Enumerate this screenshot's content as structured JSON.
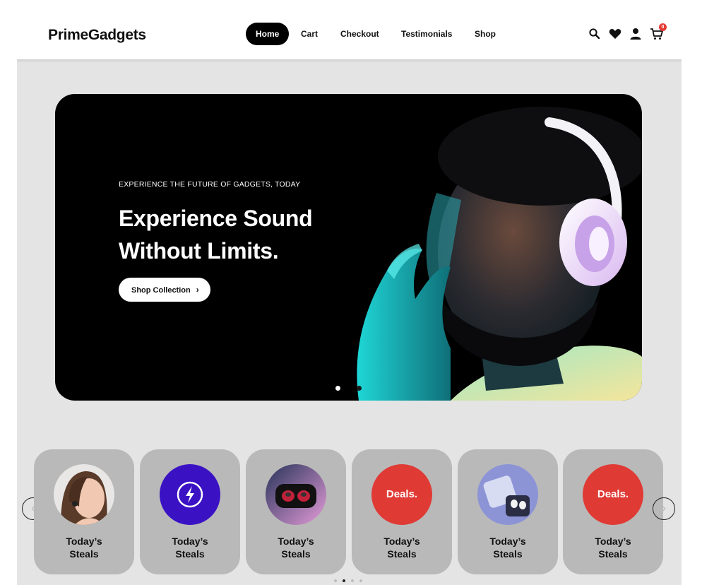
{
  "header": {
    "logo": "PrimeGadgets",
    "nav": [
      {
        "label": "Home",
        "active": true
      },
      {
        "label": "Cart",
        "active": false
      },
      {
        "label": "Checkout",
        "active": false
      },
      {
        "label": "Testimonials",
        "active": false
      },
      {
        "label": "Shop",
        "active": false
      }
    ],
    "icons": [
      "search-icon",
      "heart-icon",
      "user-icon",
      "cart-icon"
    ],
    "cart_count": "0"
  },
  "hero": {
    "eyebrow": "EXPERIENCE THE FUTURE OF GADGETS, TODAY",
    "headline_line1": "Experience Sound",
    "headline_line2": "Without Limits.",
    "cta_label": "Shop Collection",
    "cta_icon": "chevron-right-icon",
    "slide_count": 2,
    "active_slide": 1
  },
  "categories": {
    "items": [
      {
        "line1": "Today’s",
        "line2": "Steals",
        "image": "woman-earbuds"
      },
      {
        "line1": "Today’s",
        "line2": "Steals",
        "image": "lightning-icon"
      },
      {
        "line1": "Today’s",
        "line2": "Steals",
        "image": "earbuds-case"
      },
      {
        "line1": "Today’s",
        "line2": "Steals",
        "badge": "Deals."
      },
      {
        "line1": "Today’s",
        "line2": "Steals",
        "image": "earbuds-case-blue"
      },
      {
        "line1": "Today’s",
        "line2": "Steals",
        "badge": "Deals."
      }
    ],
    "page_count": 4,
    "active_page": 2
  },
  "colors": {
    "accent": "#000000",
    "deals_red": "#e03a35",
    "lightning_purple": "#3a12c4",
    "card_bg": "#b9b9b9",
    "page_bg": "#e4e4e4"
  }
}
